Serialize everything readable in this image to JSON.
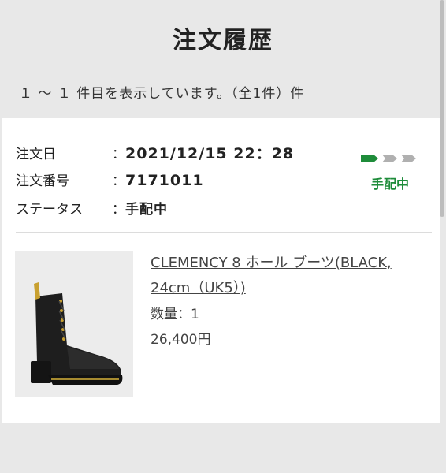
{
  "page": {
    "title": "注文履歴",
    "result_count": "１ ～ １ 件目を表示しています。（全1件）件"
  },
  "order": {
    "date_label": "注文日",
    "date_value": "2021/12/15 22：28",
    "number_label": "注文番号",
    "number_value": "7171011",
    "status_label": "ステータス",
    "status_value": "手配中",
    "status_badge": "手配中",
    "colon": "："
  },
  "product": {
    "name": "CLEMENCY 8 ホール ブーツ(BLACK, 24cm（UK5）)",
    "quantity": "数量：1",
    "price": "26,400円",
    "image_icon": "boot-image"
  },
  "colors": {
    "background": "#e8e8e8",
    "card": "#ffffff",
    "status_green": "#1e8c3a",
    "status_gray": "#b0b0b0"
  }
}
